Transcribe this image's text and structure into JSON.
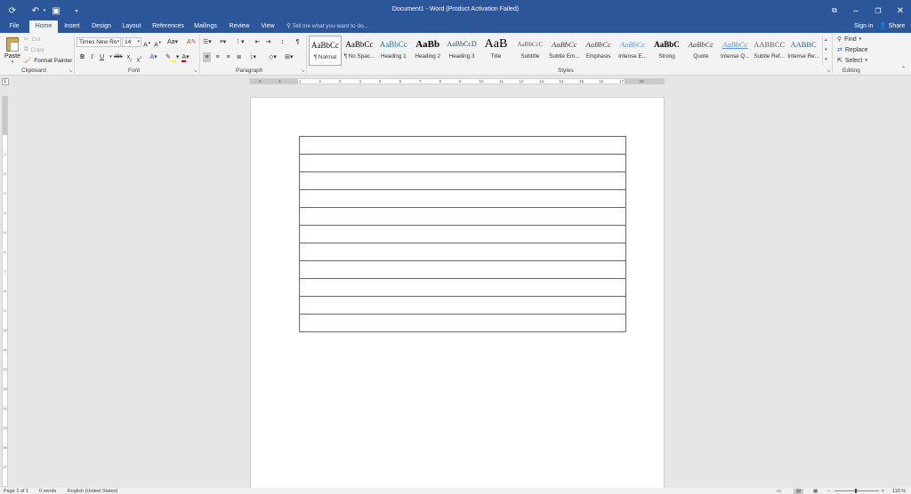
{
  "window": {
    "title": "Document1 - Word (Product Activation Failed)"
  },
  "tabs": [
    "File",
    "Home",
    "Insert",
    "Design",
    "Layout",
    "References",
    "Mailings",
    "Review",
    "View"
  ],
  "active_tab": "Home",
  "tellme": {
    "placeholder": "Tell me what you want to do..."
  },
  "account": {
    "signin": "Sign in",
    "share": "Share"
  },
  "clipboard": {
    "label": "Clipboard",
    "paste": "Paste",
    "cut": "Cut",
    "copy": "Copy",
    "format_painter": "Format Painter"
  },
  "font": {
    "label": "Font",
    "name": "Times New Ro",
    "size": "14"
  },
  "paragraph": {
    "label": "Paragraph"
  },
  "styles": {
    "label": "Styles",
    "items": [
      {
        "sample": "AaBbCc",
        "name": "¶ Normal"
      },
      {
        "sample": "AaBbCc",
        "name": "¶ No Spac..."
      },
      {
        "sample": "AaBbCc",
        "name": "Heading 1"
      },
      {
        "sample": "AaBb",
        "name": "Heading 2"
      },
      {
        "sample": "AaBbCcD",
        "name": "Heading 3"
      },
      {
        "sample": "AaB",
        "name": "Title"
      },
      {
        "sample": "AaBbCcC",
        "name": "Subtitle"
      },
      {
        "sample": "AaBbCc",
        "name": "Subtle Em..."
      },
      {
        "sample": "AaBbCc",
        "name": "Emphasis"
      },
      {
        "sample": "AaBbCc",
        "name": "Intense E..."
      },
      {
        "sample": "AaBbC",
        "name": "Strong"
      },
      {
        "sample": "AaBbCc",
        "name": "Quote"
      },
      {
        "sample": "AaBbCc",
        "name": "Intense Q..."
      },
      {
        "sample": "AABBCC",
        "name": "Subtle Ref..."
      },
      {
        "sample": "AABBC",
        "name": "Intense Re..."
      }
    ]
  },
  "editing": {
    "label": "Editing",
    "find": "Find",
    "replace": "Replace",
    "select": "Select"
  },
  "ruler": {
    "h_ticks": [
      "2",
      "1",
      "1",
      "2",
      "3",
      "4",
      "5",
      "6",
      "7",
      "8",
      "9",
      "10",
      "11",
      "12",
      "13",
      "14",
      "15",
      "16",
      "17",
      "18"
    ],
    "v_ticks": [
      "1",
      "2",
      "3",
      "4",
      "5",
      "6",
      "7",
      "8",
      "9",
      "10",
      "11",
      "12",
      "13",
      "14",
      "15",
      "16",
      "17"
    ]
  },
  "table": {
    "rows": 11
  },
  "status": {
    "page": "Page 1 of 1",
    "words": "0 words",
    "language": "English (United States)",
    "zoom": "110 %"
  },
  "colors": {
    "brand": "#2b579a",
    "highlight": "#ffff00",
    "font_color": "#c00000"
  }
}
